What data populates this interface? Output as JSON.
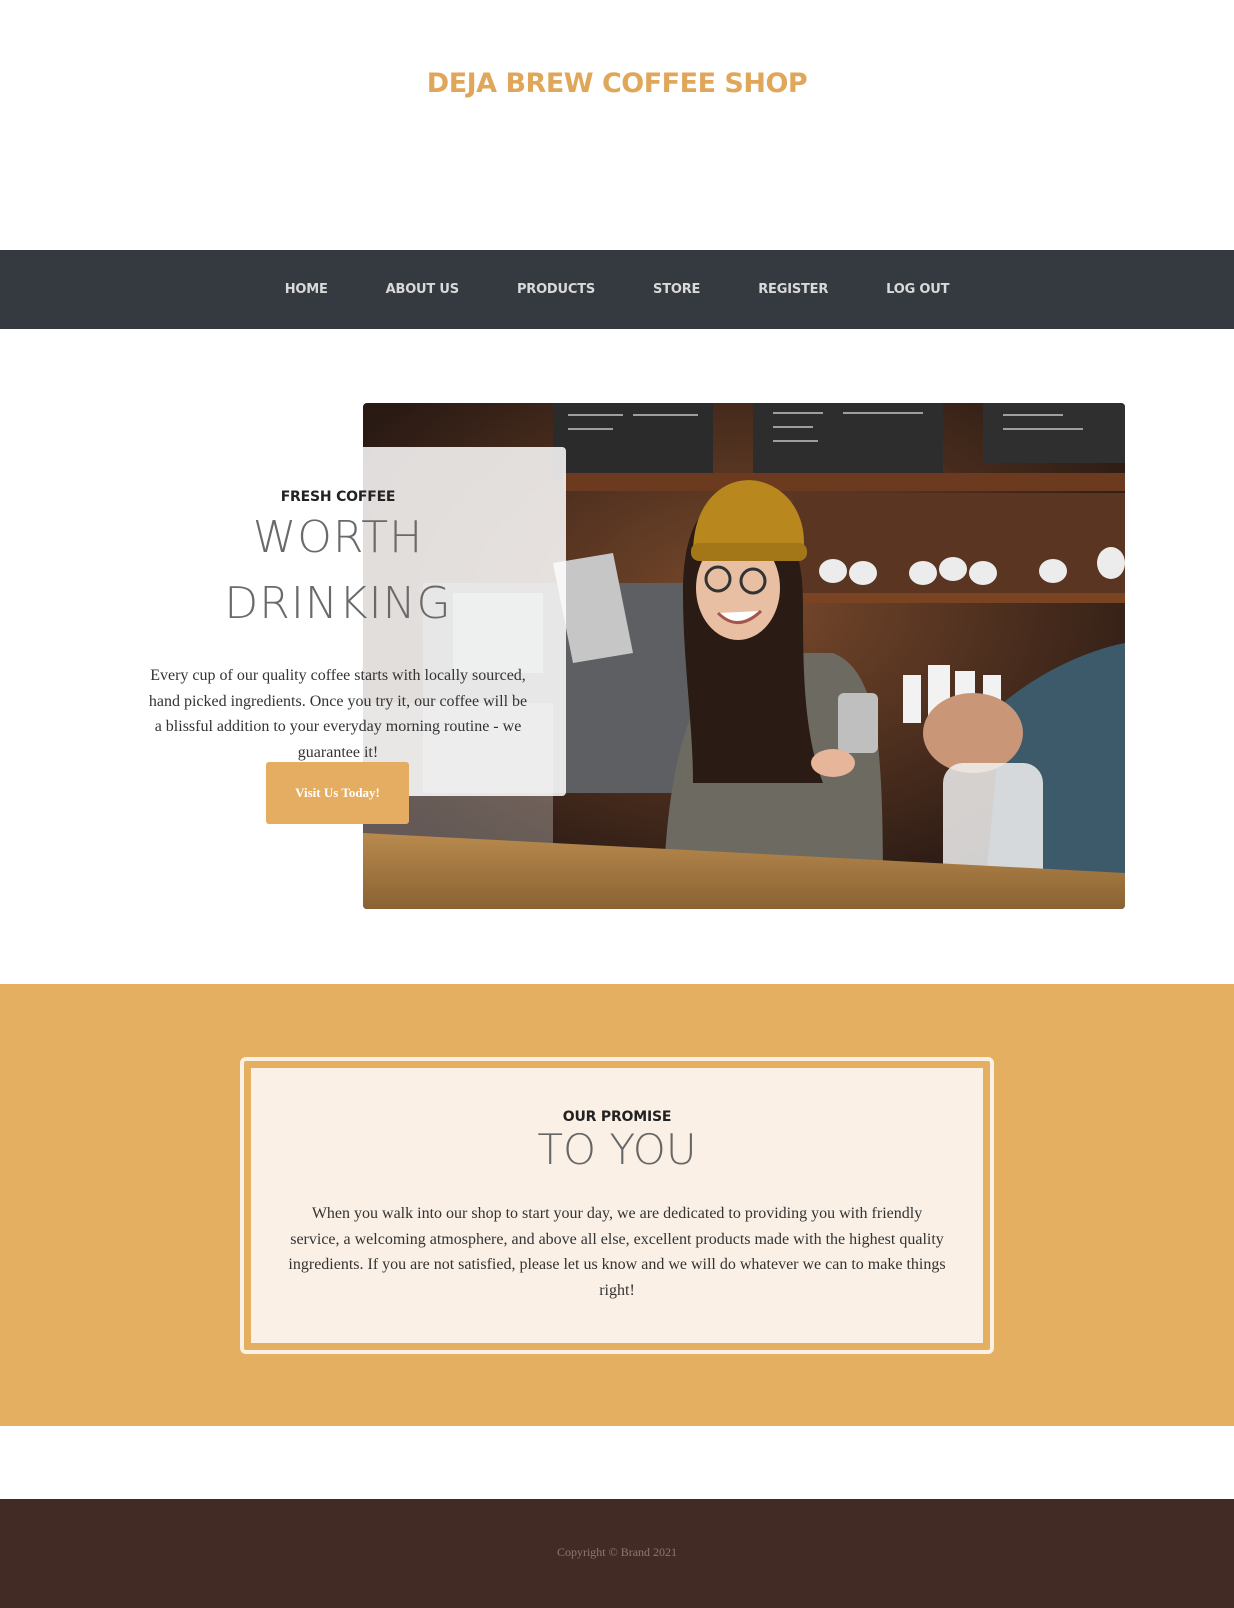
{
  "header": {
    "brand": "DEJA BREW COFFEE SHOP"
  },
  "nav": {
    "items": [
      "HOME",
      "ABOUT US",
      "PRODUCTS",
      "STORE",
      "REGISTER",
      "LOG OUT"
    ]
  },
  "hero": {
    "eyebrow": "FRESH COFFEE",
    "heading_line1": "WORTH",
    "heading_line2": "DRINKING",
    "body": "Every cup of our quality coffee starts with locally sourced, hand picked ingredients. Once you try it, our coffee will be a blissful addition to your everyday morning routine - we guarantee it!",
    "button": "Visit Us Today!"
  },
  "promise": {
    "eyebrow": "OUR PROMISE",
    "heading": "TO YOU",
    "body": "When you walk into our shop to start your day, we are dedicated to providing you with friendly service, a welcoming atmosphere, and above all else, excellent products made with the highest quality ingredients. If you are not satisfied, please let us know and we will do whatever we can to make things right!"
  },
  "footer": {
    "copyright": "Copyright © Brand 2021"
  },
  "colors": {
    "accent": "#e5af62",
    "nav_bg": "#343a40",
    "footer_bg": "#432b25",
    "card_bg": "#faf0e5"
  }
}
